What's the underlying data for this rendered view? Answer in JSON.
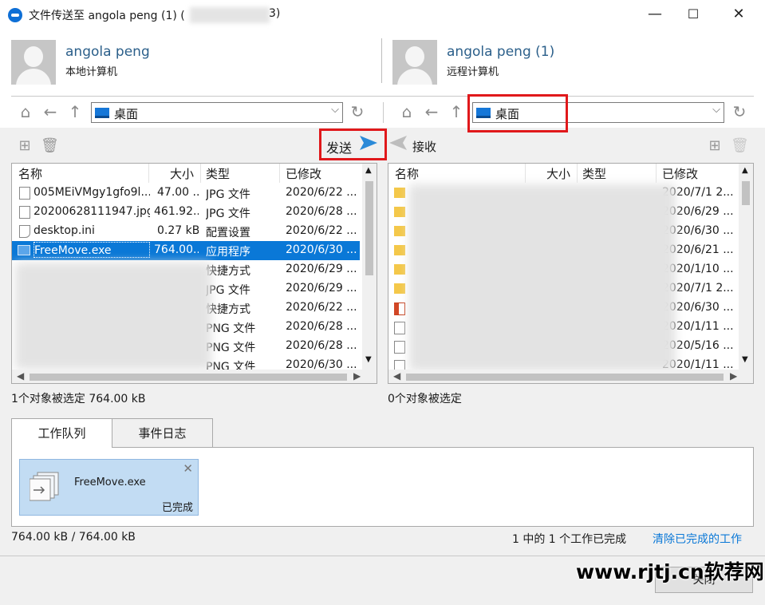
{
  "window": {
    "title": "文件传送至 angola peng (1) (",
    "title_suffix": "3)",
    "controls": [
      "—",
      "☐",
      "✕"
    ]
  },
  "local": {
    "name": "angola peng",
    "subtitle": "本地计算机"
  },
  "remote": {
    "name": "angola peng (1)",
    "subtitle": "远程计算机"
  },
  "nav": {
    "local_path": "桌面",
    "remote_path": "桌面"
  },
  "actions": {
    "send_label": "发送",
    "receive_label": "接收"
  },
  "local_list": {
    "columns": [
      "名称",
      "大小",
      "类型",
      "已修改"
    ],
    "rows": [
      {
        "name": "005MEiVMgy1gfo9l...",
        "size": "47.00 ...",
        "type": "JPG 文件",
        "date": "2020/6/22 ..."
      },
      {
        "name": "20200628111947.jpg",
        "size": "461.92...",
        "type": "JPG 文件",
        "date": "2020/6/28 ..."
      },
      {
        "name": "desktop.ini",
        "size": "0.27 kB",
        "type": "配置设置",
        "date": "2020/6/22 ..."
      },
      {
        "name": "FreeMove.exe",
        "size": "764.00...",
        "type": "应用程序",
        "date": "2020/6/30 ..."
      },
      {
        "name": "",
        "size": "",
        "type": "快捷方式",
        "date": "2020/6/29 ..."
      },
      {
        "name": "",
        "size": "",
        "type": "JPG 文件",
        "date": "2020/6/29 ..."
      },
      {
        "name": "",
        "size": "",
        "type": "快捷方式",
        "date": "2020/6/22 ..."
      },
      {
        "name": "",
        "size": "",
        "type": "PNG 文件",
        "date": "2020/6/28 ..."
      },
      {
        "name": "",
        "size": "",
        "type": "PNG 文件",
        "date": "2020/6/28 ..."
      },
      {
        "name": "",
        "size": "",
        "type": "PNG 文件",
        "date": "2020/6/30 ..."
      }
    ],
    "selected_index": 3
  },
  "remote_list": {
    "columns": [
      "名称",
      "大小",
      "类型",
      "已修改"
    ],
    "dates": [
      "2020/7/1 2...",
      "2020/6/29 ...",
      "2020/6/30 ...",
      "2020/6/21 ...",
      "2020/1/10 ...",
      "2020/7/1 2...",
      "2020/6/30 ...",
      "2020/1/11 ...",
      "2020/5/16 ...",
      "2020/1/11 ..."
    ]
  },
  "status": {
    "local_selection": "1个对象被选定  764.00 kB",
    "remote_selection": "0个对象被选定"
  },
  "tabs": [
    "工作队列",
    "事件日志"
  ],
  "queue": {
    "file": "FreeMove.exe",
    "state": "已完成"
  },
  "footer": {
    "progress": "764.00 kB / 764.00 kB",
    "summary": "1 中的 1 个工作已完成",
    "clear_link": "清除已完成的工作",
    "close_button": "关闭"
  },
  "watermark": "www.rjtj.cn软荐网",
  "colors": {
    "accent": "#0a78d7",
    "highlight_box": "#e0181b",
    "link": "#0a78d7"
  }
}
